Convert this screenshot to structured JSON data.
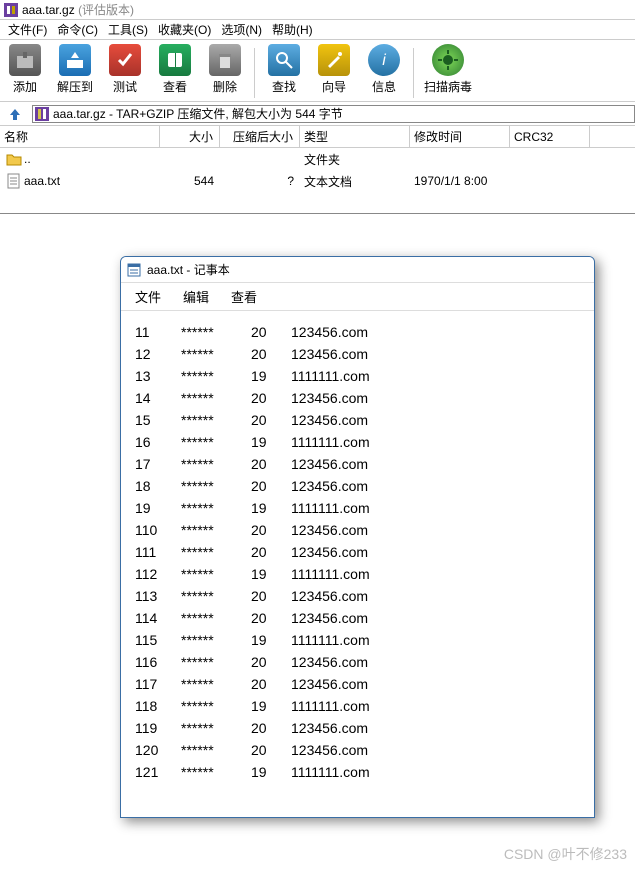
{
  "title": {
    "filename": "aaa.tar.gz",
    "eval": "(评估版本)"
  },
  "menus": {
    "file": "文件(F)",
    "cmd": "命令(C)",
    "tool": "工具(S)",
    "fav": "收藏夹(O)",
    "opt": "选项(N)",
    "help": "帮助(H)"
  },
  "toolbar": {
    "add": "添加",
    "extract": "解压到",
    "test": "测试",
    "view": "查看",
    "delete": "删除",
    "find": "查找",
    "wizard": "向导",
    "info": "信息",
    "scan": "扫描病毒"
  },
  "address_path": "aaa.tar.gz - TAR+GZIP 压缩文件, 解包大小为 544 字节",
  "columns": {
    "name": "名称",
    "size": "大小",
    "packed": "压缩后大小",
    "type": "类型",
    "mtime": "修改时间",
    "crc": "CRC32"
  },
  "rows": [
    {
      "name": "..",
      "size": "",
      "packed": "",
      "type": "文件夹",
      "mtime": "",
      "crc": "",
      "is_folder": true
    },
    {
      "name": "aaa.txt",
      "size": "544",
      "packed": "?",
      "type": "文本文档",
      "mtime": "1970/1/1 8:00",
      "crc": "",
      "is_folder": false
    }
  ],
  "notepad": {
    "title": "aaa.txt - 记事本",
    "menus": {
      "file": "文件",
      "edit": "编辑",
      "view": "查看"
    },
    "lines": [
      {
        "id": "11",
        "mask": "******",
        "n": "20",
        "dom": "123456.com"
      },
      {
        "id": "12",
        "mask": "******",
        "n": "20",
        "dom": "123456.com"
      },
      {
        "id": "13",
        "mask": "******",
        "n": "19",
        "dom": "1111111.com"
      },
      {
        "id": "14",
        "mask": "******",
        "n": "20",
        "dom": "123456.com"
      },
      {
        "id": "15",
        "mask": "******",
        "n": "20",
        "dom": "123456.com"
      },
      {
        "id": "16",
        "mask": "******",
        "n": "19",
        "dom": "1111111.com"
      },
      {
        "id": "17",
        "mask": "******",
        "n": "20",
        "dom": "123456.com"
      },
      {
        "id": "18",
        "mask": "******",
        "n": "20",
        "dom": "123456.com"
      },
      {
        "id": "19",
        "mask": "******",
        "n": "19",
        "dom": "1111111.com"
      },
      {
        "id": "110",
        "mask": "******",
        "n": "20",
        "dom": "123456.com"
      },
      {
        "id": "111",
        "mask": "******",
        "n": "20",
        "dom": "123456.com"
      },
      {
        "id": "112",
        "mask": "******",
        "n": "19",
        "dom": "1111111.com"
      },
      {
        "id": "113",
        "mask": "******",
        "n": "20",
        "dom": "123456.com"
      },
      {
        "id": "114",
        "mask": "******",
        "n": "20",
        "dom": "123456.com"
      },
      {
        "id": "115",
        "mask": "******",
        "n": "19",
        "dom": "1111111.com"
      },
      {
        "id": "116",
        "mask": "******",
        "n": "20",
        "dom": "123456.com"
      },
      {
        "id": "117",
        "mask": "******",
        "n": "20",
        "dom": "123456.com"
      },
      {
        "id": "118",
        "mask": "******",
        "n": "19",
        "dom": "1111111.com"
      },
      {
        "id": "119",
        "mask": "******",
        "n": "20",
        "dom": "123456.com"
      },
      {
        "id": "120",
        "mask": "******",
        "n": "20",
        "dom": "123456.com"
      },
      {
        "id": "121",
        "mask": "******",
        "n": "19",
        "dom": "1111111.com"
      }
    ]
  },
  "watermark": "CSDN @叶不修233"
}
